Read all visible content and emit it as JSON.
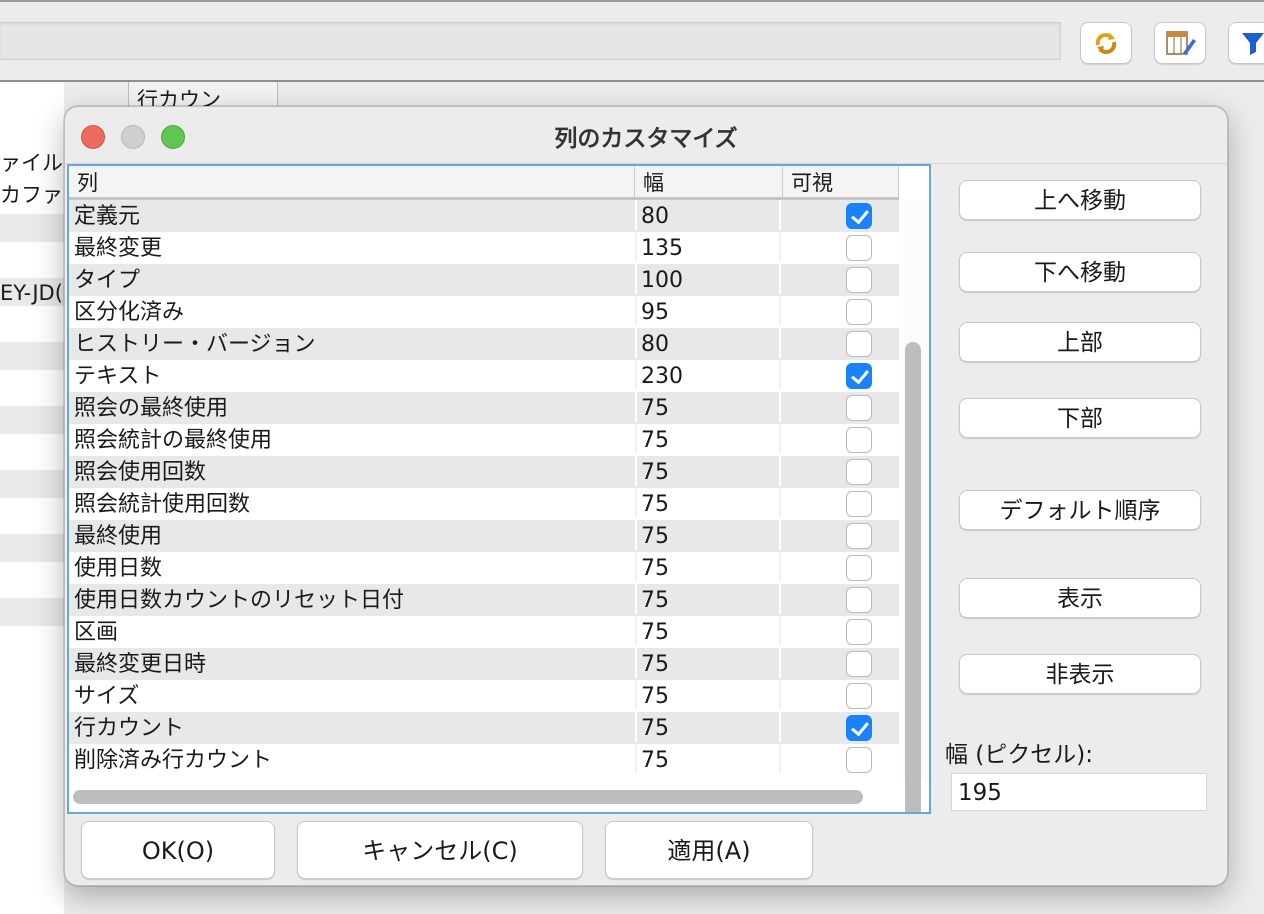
{
  "background": {
    "header_cell": "行カウン",
    "rows": [
      "ァイル",
      "カファ",
      "EY-JD("
    ]
  },
  "dialog": {
    "title": "列のカスタマイズ",
    "columns": {
      "name": "列",
      "width": "幅",
      "visible": "可視"
    },
    "rows": [
      {
        "name": "定義元",
        "width": "80",
        "visible": true
      },
      {
        "name": "最終変更",
        "width": "135",
        "visible": false
      },
      {
        "name": "タイプ",
        "width": "100",
        "visible": false
      },
      {
        "name": "区分化済み",
        "width": "95",
        "visible": false
      },
      {
        "name": "ヒストリー・バージョン",
        "width": "80",
        "visible": false
      },
      {
        "name": "テキスト",
        "width": "230",
        "visible": true
      },
      {
        "name": "照会の最終使用",
        "width": "75",
        "visible": false
      },
      {
        "name": "照会統計の最終使用",
        "width": "75",
        "visible": false
      },
      {
        "name": "照会使用回数",
        "width": "75",
        "visible": false
      },
      {
        "name": "照会統計使用回数",
        "width": "75",
        "visible": false
      },
      {
        "name": "最終使用",
        "width": "75",
        "visible": false
      },
      {
        "name": "使用日数",
        "width": "75",
        "visible": false
      },
      {
        "name": "使用日数カウントのリセット日付",
        "width": "75",
        "visible": false
      },
      {
        "name": "区画",
        "width": "75",
        "visible": false
      },
      {
        "name": "最終変更日時",
        "width": "75",
        "visible": false
      },
      {
        "name": "サイズ",
        "width": "75",
        "visible": false
      },
      {
        "name": "行カウント",
        "width": "75",
        "visible": true
      },
      {
        "name": "削除済み行カウント",
        "width": "75",
        "visible": false
      }
    ],
    "side_buttons": {
      "move_up": "上へ移動",
      "move_down": "下へ移動",
      "top": "上部",
      "bottom": "下部",
      "default_order": "デフォルト順序",
      "show": "表示",
      "hide": "非表示"
    },
    "width_label": "幅 (ピクセル):",
    "width_value": "195",
    "buttons": {
      "ok": "OK(O)",
      "cancel": "キャンセル(C)",
      "apply": "適用(A)"
    }
  },
  "icons": {
    "refresh": "refresh-icon",
    "edit_columns": "edit-columns-icon",
    "filter": "filter-icon"
  },
  "colors": {
    "accent": "#1a82fb",
    "focus_border": "#6aa6de"
  }
}
